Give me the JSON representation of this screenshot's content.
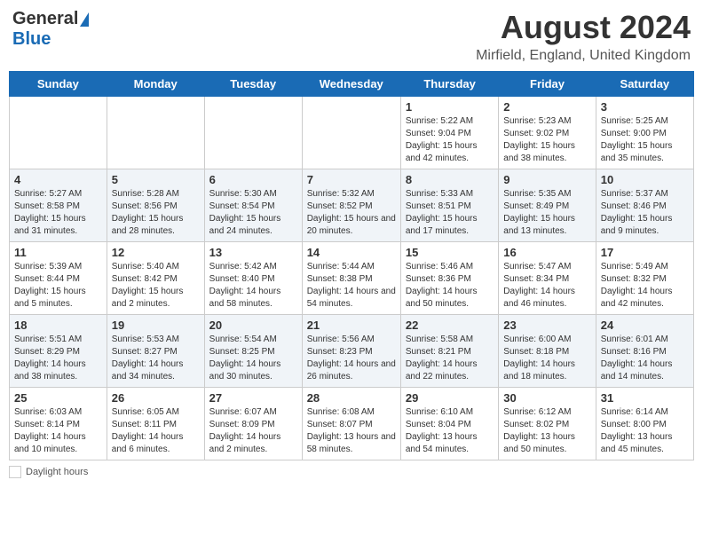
{
  "header": {
    "logo_general": "General",
    "logo_blue": "Blue",
    "month_year": "August 2024",
    "location": "Mirfield, England, United Kingdom"
  },
  "calendar": {
    "weekdays": [
      "Sunday",
      "Monday",
      "Tuesday",
      "Wednesday",
      "Thursday",
      "Friday",
      "Saturday"
    ],
    "weeks": [
      [
        {
          "day": "",
          "info": ""
        },
        {
          "day": "",
          "info": ""
        },
        {
          "day": "",
          "info": ""
        },
        {
          "day": "",
          "info": ""
        },
        {
          "day": "1",
          "info": "Sunrise: 5:22 AM\nSunset: 9:04 PM\nDaylight: 15 hours and 42 minutes."
        },
        {
          "day": "2",
          "info": "Sunrise: 5:23 AM\nSunset: 9:02 PM\nDaylight: 15 hours and 38 minutes."
        },
        {
          "day": "3",
          "info": "Sunrise: 5:25 AM\nSunset: 9:00 PM\nDaylight: 15 hours and 35 minutes."
        }
      ],
      [
        {
          "day": "4",
          "info": "Sunrise: 5:27 AM\nSunset: 8:58 PM\nDaylight: 15 hours and 31 minutes."
        },
        {
          "day": "5",
          "info": "Sunrise: 5:28 AM\nSunset: 8:56 PM\nDaylight: 15 hours and 28 minutes."
        },
        {
          "day": "6",
          "info": "Sunrise: 5:30 AM\nSunset: 8:54 PM\nDaylight: 15 hours and 24 minutes."
        },
        {
          "day": "7",
          "info": "Sunrise: 5:32 AM\nSunset: 8:52 PM\nDaylight: 15 hours and 20 minutes."
        },
        {
          "day": "8",
          "info": "Sunrise: 5:33 AM\nSunset: 8:51 PM\nDaylight: 15 hours and 17 minutes."
        },
        {
          "day": "9",
          "info": "Sunrise: 5:35 AM\nSunset: 8:49 PM\nDaylight: 15 hours and 13 minutes."
        },
        {
          "day": "10",
          "info": "Sunrise: 5:37 AM\nSunset: 8:46 PM\nDaylight: 15 hours and 9 minutes."
        }
      ],
      [
        {
          "day": "11",
          "info": "Sunrise: 5:39 AM\nSunset: 8:44 PM\nDaylight: 15 hours and 5 minutes."
        },
        {
          "day": "12",
          "info": "Sunrise: 5:40 AM\nSunset: 8:42 PM\nDaylight: 15 hours and 2 minutes."
        },
        {
          "day": "13",
          "info": "Sunrise: 5:42 AM\nSunset: 8:40 PM\nDaylight: 14 hours and 58 minutes."
        },
        {
          "day": "14",
          "info": "Sunrise: 5:44 AM\nSunset: 8:38 PM\nDaylight: 14 hours and 54 minutes."
        },
        {
          "day": "15",
          "info": "Sunrise: 5:46 AM\nSunset: 8:36 PM\nDaylight: 14 hours and 50 minutes."
        },
        {
          "day": "16",
          "info": "Sunrise: 5:47 AM\nSunset: 8:34 PM\nDaylight: 14 hours and 46 minutes."
        },
        {
          "day": "17",
          "info": "Sunrise: 5:49 AM\nSunset: 8:32 PM\nDaylight: 14 hours and 42 minutes."
        }
      ],
      [
        {
          "day": "18",
          "info": "Sunrise: 5:51 AM\nSunset: 8:29 PM\nDaylight: 14 hours and 38 minutes."
        },
        {
          "day": "19",
          "info": "Sunrise: 5:53 AM\nSunset: 8:27 PM\nDaylight: 14 hours and 34 minutes."
        },
        {
          "day": "20",
          "info": "Sunrise: 5:54 AM\nSunset: 8:25 PM\nDaylight: 14 hours and 30 minutes."
        },
        {
          "day": "21",
          "info": "Sunrise: 5:56 AM\nSunset: 8:23 PM\nDaylight: 14 hours and 26 minutes."
        },
        {
          "day": "22",
          "info": "Sunrise: 5:58 AM\nSunset: 8:21 PM\nDaylight: 14 hours and 22 minutes."
        },
        {
          "day": "23",
          "info": "Sunrise: 6:00 AM\nSunset: 8:18 PM\nDaylight: 14 hours and 18 minutes."
        },
        {
          "day": "24",
          "info": "Sunrise: 6:01 AM\nSunset: 8:16 PM\nDaylight: 14 hours and 14 minutes."
        }
      ],
      [
        {
          "day": "25",
          "info": "Sunrise: 6:03 AM\nSunset: 8:14 PM\nDaylight: 14 hours and 10 minutes."
        },
        {
          "day": "26",
          "info": "Sunrise: 6:05 AM\nSunset: 8:11 PM\nDaylight: 14 hours and 6 minutes."
        },
        {
          "day": "27",
          "info": "Sunrise: 6:07 AM\nSunset: 8:09 PM\nDaylight: 14 hours and 2 minutes."
        },
        {
          "day": "28",
          "info": "Sunrise: 6:08 AM\nSunset: 8:07 PM\nDaylight: 13 hours and 58 minutes."
        },
        {
          "day": "29",
          "info": "Sunrise: 6:10 AM\nSunset: 8:04 PM\nDaylight: 13 hours and 54 minutes."
        },
        {
          "day": "30",
          "info": "Sunrise: 6:12 AM\nSunset: 8:02 PM\nDaylight: 13 hours and 50 minutes."
        },
        {
          "day": "31",
          "info": "Sunrise: 6:14 AM\nSunset: 8:00 PM\nDaylight: 13 hours and 45 minutes."
        }
      ]
    ]
  },
  "footer": {
    "daylight_label": "Daylight hours"
  }
}
